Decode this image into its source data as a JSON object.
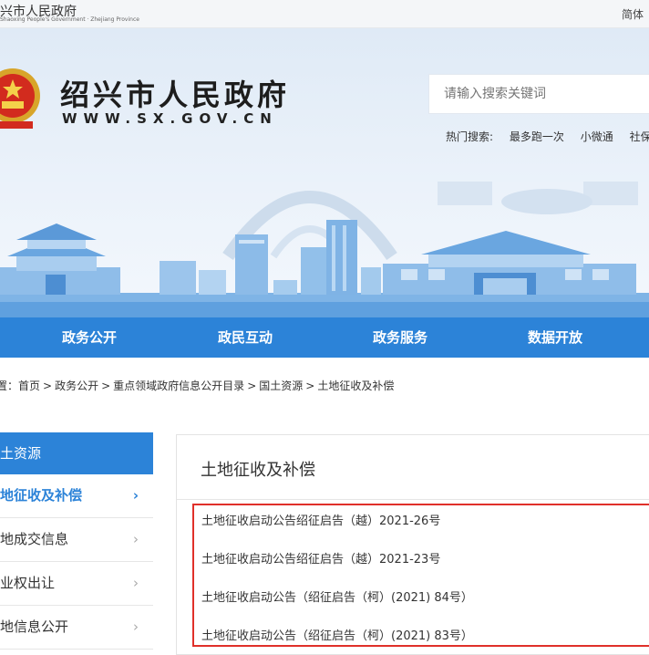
{
  "top": {
    "logo": "兴市人民政府",
    "logo_sub": "Shaoxing People's Government · Zhejiang Province",
    "lang": "简体"
  },
  "header": {
    "title": "绍兴市人民政府",
    "url": "WWW.SX.GOV.CN",
    "search_placeholder": "请输入搜索关键词",
    "hot_label": "热门搜索:",
    "hot_terms": [
      "最多跑一次",
      "小微通",
      "社保"
    ]
  },
  "nav": [
    "政务公开",
    "政民互动",
    "政务服务",
    "数据开放"
  ],
  "breadcrumb": {
    "prefix": "置：",
    "items": [
      "首页",
      "政务公开",
      "重点领域政府信息公开目录",
      "国土资源",
      "土地征收及补偿"
    ],
    "separator": ">"
  },
  "sidebar": {
    "head": "土资源",
    "items": [
      {
        "label": "地征收及补偿",
        "active": true
      },
      {
        "label": "地成交信息",
        "active": false
      },
      {
        "label": "业权出让",
        "active": false
      },
      {
        "label": "地信息公开",
        "active": false
      }
    ],
    "arrow": "›"
  },
  "main": {
    "title": "土地征收及补偿",
    "list": [
      "土地征收启动公告绍征启告（越）2021-26号",
      "土地征收启动公告绍征启告（越）2021-23号",
      "土地征收启动公告（绍征启告（柯）(2021) 84号）",
      "土地征收启动公告（绍征启告（柯）(2021) 83号）"
    ]
  },
  "colors": {
    "accent": "#2c83d8",
    "highlight_border": "#e0302a"
  }
}
